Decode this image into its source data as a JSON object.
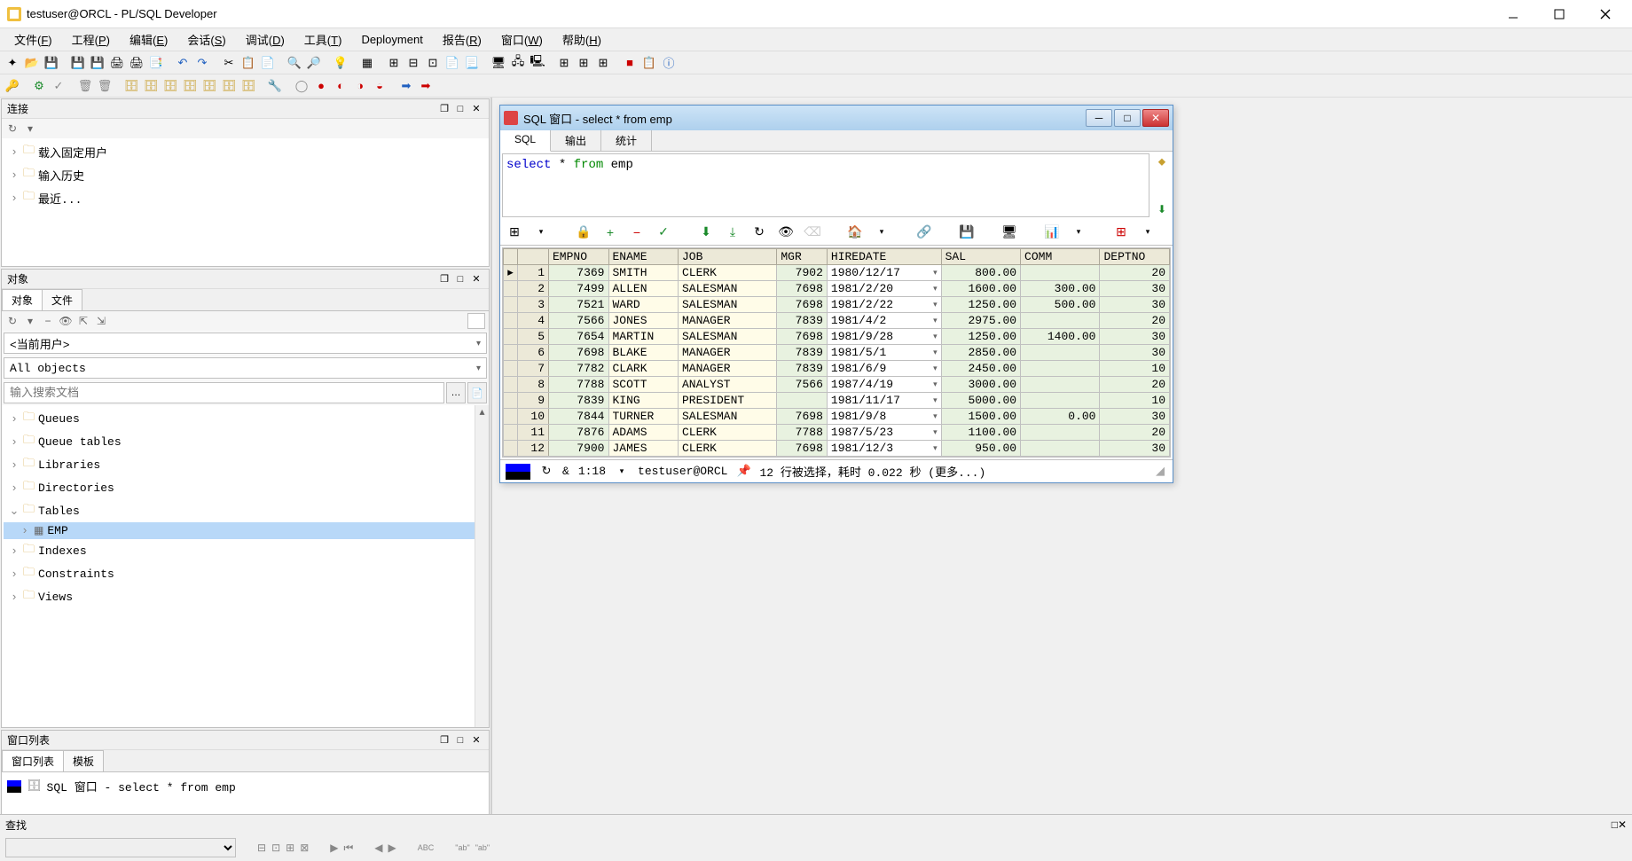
{
  "titlebar": {
    "title": "testuser@ORCL - PL/SQL Developer"
  },
  "menubar": [
    "文件(F)",
    "工程(P)",
    "编辑(E)",
    "会话(S)",
    "调试(D)",
    "工具(T)",
    "Deployment",
    "报告(R)",
    "窗口(W)",
    "帮助(H)"
  ],
  "connection_panel": {
    "title": "连接",
    "items": [
      "载入固定用户",
      "输入历史",
      "最近..."
    ]
  },
  "object_panel": {
    "title": "对象",
    "tabs": [
      "对象",
      "文件"
    ],
    "user_dropdown": "<当前用户>",
    "filter_dropdown": "All objects",
    "search_placeholder": "输入搜索文档",
    "tree": [
      {
        "label": "Queues",
        "expanded": false
      },
      {
        "label": "Queue tables",
        "expanded": false
      },
      {
        "label": "Libraries",
        "expanded": false
      },
      {
        "label": "Directories",
        "expanded": false
      },
      {
        "label": "Tables",
        "expanded": true,
        "children": [
          {
            "label": "EMP",
            "selected": true,
            "icon": "table"
          }
        ]
      },
      {
        "label": "Indexes",
        "expanded": false
      },
      {
        "label": "Constraints",
        "expanded": false
      },
      {
        "label": "Views",
        "expanded": false
      }
    ]
  },
  "winlist_panel": {
    "title": "窗口列表",
    "tabs": [
      "窗口列表",
      "模板"
    ],
    "item": "SQL 窗口 - select * from emp"
  },
  "sql_window": {
    "title": "SQL 窗口 - select * from emp",
    "tabs": [
      "SQL",
      "输出",
      "统计"
    ],
    "query_tokens": [
      {
        "t": "select",
        "c": "sql-kw-select"
      },
      {
        "t": " * ",
        "c": "sql-text"
      },
      {
        "t": "from",
        "c": "sql-kw-from"
      },
      {
        "t": " emp",
        "c": "sql-text"
      }
    ],
    "columns": [
      "",
      "",
      "EMPNO",
      "ENAME",
      "JOB",
      "MGR",
      "HIREDATE",
      "SAL",
      "COMM",
      "DEPTNO"
    ],
    "status": {
      "pos": "1:18",
      "amp": "&",
      "user": "testuser@ORCL",
      "msg": "12 行被选择，耗时 0.022 秒 (更多...)"
    }
  },
  "find_panel": {
    "title": "查找"
  },
  "chart_data": {
    "type": "table",
    "columns": [
      "EMPNO",
      "ENAME",
      "JOB",
      "MGR",
      "HIREDATE",
      "SAL",
      "COMM",
      "DEPTNO"
    ],
    "rows": [
      {
        "EMPNO": 7369,
        "ENAME": "SMITH",
        "JOB": "CLERK",
        "MGR": 7902,
        "HIREDATE": "1980/12/17",
        "SAL": 800.0,
        "COMM": null,
        "DEPTNO": 20
      },
      {
        "EMPNO": 7499,
        "ENAME": "ALLEN",
        "JOB": "SALESMAN",
        "MGR": 7698,
        "HIREDATE": "1981/2/20",
        "SAL": 1600.0,
        "COMM": 300.0,
        "DEPTNO": 30
      },
      {
        "EMPNO": 7521,
        "ENAME": "WARD",
        "JOB": "SALESMAN",
        "MGR": 7698,
        "HIREDATE": "1981/2/22",
        "SAL": 1250.0,
        "COMM": 500.0,
        "DEPTNO": 30
      },
      {
        "EMPNO": 7566,
        "ENAME": "JONES",
        "JOB": "MANAGER",
        "MGR": 7839,
        "HIREDATE": "1981/4/2",
        "SAL": 2975.0,
        "COMM": null,
        "DEPTNO": 20
      },
      {
        "EMPNO": 7654,
        "ENAME": "MARTIN",
        "JOB": "SALESMAN",
        "MGR": 7698,
        "HIREDATE": "1981/9/28",
        "SAL": 1250.0,
        "COMM": 1400.0,
        "DEPTNO": 30
      },
      {
        "EMPNO": 7698,
        "ENAME": "BLAKE",
        "JOB": "MANAGER",
        "MGR": 7839,
        "HIREDATE": "1981/5/1",
        "SAL": 2850.0,
        "COMM": null,
        "DEPTNO": 30
      },
      {
        "EMPNO": 7782,
        "ENAME": "CLARK",
        "JOB": "MANAGER",
        "MGR": 7839,
        "HIREDATE": "1981/6/9",
        "SAL": 2450.0,
        "COMM": null,
        "DEPTNO": 10
      },
      {
        "EMPNO": 7788,
        "ENAME": "SCOTT",
        "JOB": "ANALYST",
        "MGR": 7566,
        "HIREDATE": "1987/4/19",
        "SAL": 3000.0,
        "COMM": null,
        "DEPTNO": 20
      },
      {
        "EMPNO": 7839,
        "ENAME": "KING",
        "JOB": "PRESIDENT",
        "MGR": null,
        "HIREDATE": "1981/11/17",
        "SAL": 5000.0,
        "COMM": null,
        "DEPTNO": 10
      },
      {
        "EMPNO": 7844,
        "ENAME": "TURNER",
        "JOB": "SALESMAN",
        "MGR": 7698,
        "HIREDATE": "1981/9/8",
        "SAL": 1500.0,
        "COMM": 0.0,
        "DEPTNO": 30
      },
      {
        "EMPNO": 7876,
        "ENAME": "ADAMS",
        "JOB": "CLERK",
        "MGR": 7788,
        "HIREDATE": "1987/5/23",
        "SAL": 1100.0,
        "COMM": null,
        "DEPTNO": 20
      },
      {
        "EMPNO": 7900,
        "ENAME": "JAMES",
        "JOB": "CLERK",
        "MGR": 7698,
        "HIREDATE": "1981/12/3",
        "SAL": 950.0,
        "COMM": null,
        "DEPTNO": 30
      }
    ]
  }
}
